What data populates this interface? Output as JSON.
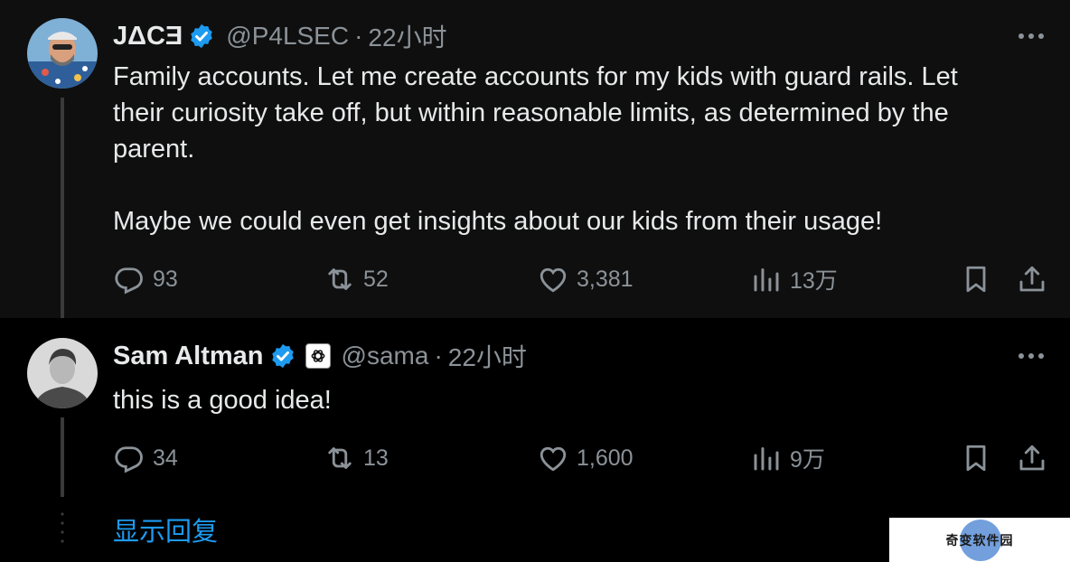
{
  "tweets": [
    {
      "display_name": "JΔCƎ",
      "handle": "@P4LSEC",
      "separator": "·",
      "time": "22小时",
      "text": "Family accounts. Let me create accounts for my kids with guard rails. Let\ntheir curiosity take off, but within reasonable limits, as determined by the\nparent.\n\nMaybe we could even get insights about our kids from their usage!",
      "replies": "93",
      "reposts": "52",
      "likes": "3,381",
      "views": "13万",
      "avatar_icon": "avatar-photo"
    },
    {
      "display_name": "Sam Altman",
      "handle": "@sama",
      "separator": "·",
      "time": "22小时",
      "text": "this is a good idea!",
      "replies": "34",
      "reposts": "13",
      "likes": "1,600",
      "views": "9万",
      "avatar_icon": "avatar-photo",
      "affiliation_icon": "openai-logo-icon"
    }
  ],
  "show_replies": "显示回复",
  "watermark": "奇变软件园",
  "colors": {
    "background": "#000000",
    "highlight_background": "#0f0f0f",
    "text": "#e7e9ea",
    "muted": "#8b9298",
    "accent": "#1d9bf0"
  }
}
